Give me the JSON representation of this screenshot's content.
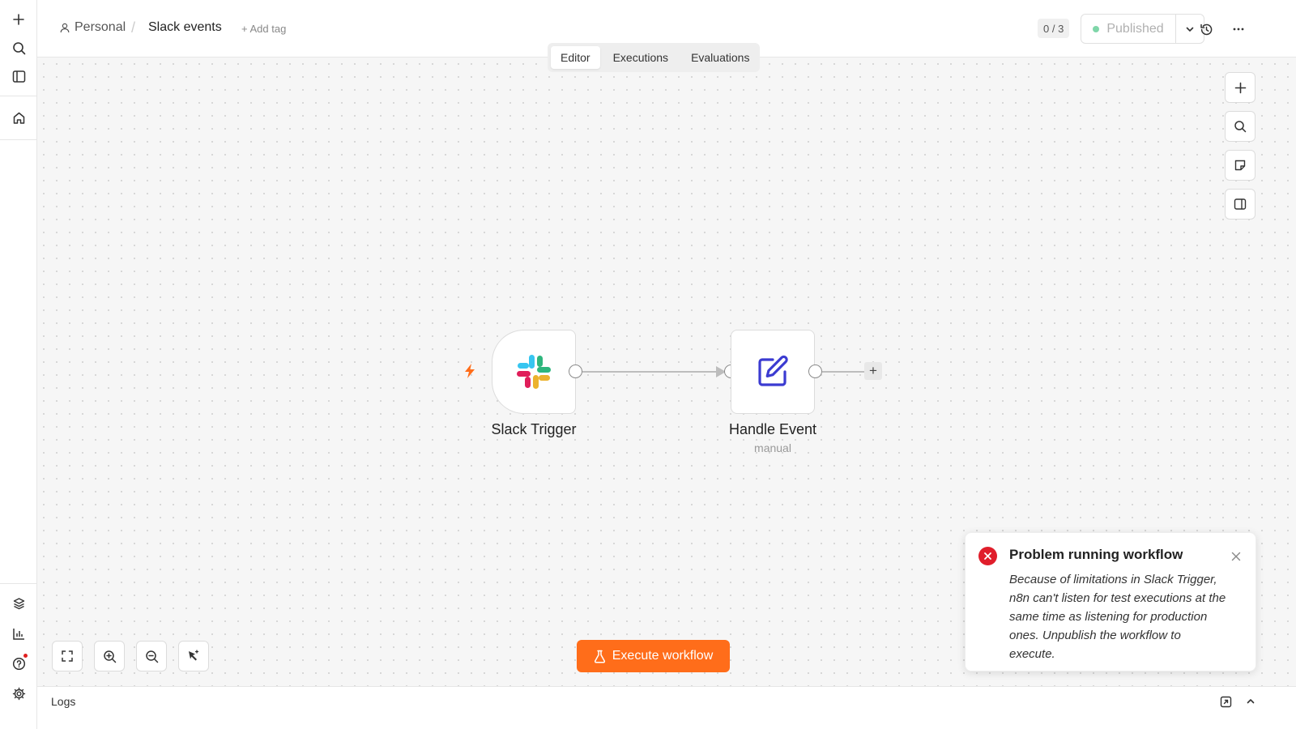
{
  "sidebar": {
    "top_icons": [
      "plus-icon",
      "search-icon",
      "sidebar-toggle-icon",
      "home-icon"
    ],
    "bottom_icons": [
      "templates-icon",
      "insights-icon",
      "help-icon",
      "settings-icon"
    ]
  },
  "header": {
    "project": "Personal",
    "separator": "/",
    "workflow_name": "Slack events",
    "add_tag": "+ Add tag",
    "counter": "0 / 3",
    "publish_label": "Published",
    "tabs": [
      {
        "label": "Editor",
        "active": true
      },
      {
        "label": "Executions",
        "active": false
      },
      {
        "label": "Evaluations",
        "active": false
      }
    ]
  },
  "canvas": {
    "nodes": [
      {
        "name": "Slack Trigger",
        "subtitle": "",
        "icon": "slack-logo-icon"
      },
      {
        "name": "Handle Event",
        "subtitle": "manual",
        "icon": "edit-icon"
      }
    ],
    "add_connector": "+",
    "execute_label": "Execute workflow"
  },
  "toast": {
    "title": "Problem running workflow",
    "message": "Because of limitations in Slack Trigger, n8n can't listen for test executions at the same time as listening for production ones. Unpublish the workflow to execute."
  },
  "logs": {
    "label": "Logs"
  },
  "colors": {
    "accent": "#ff6d1a",
    "error": "#e01e2b",
    "published_dot": "#7fd6a9",
    "edit_icon": "#3b3bd1"
  }
}
